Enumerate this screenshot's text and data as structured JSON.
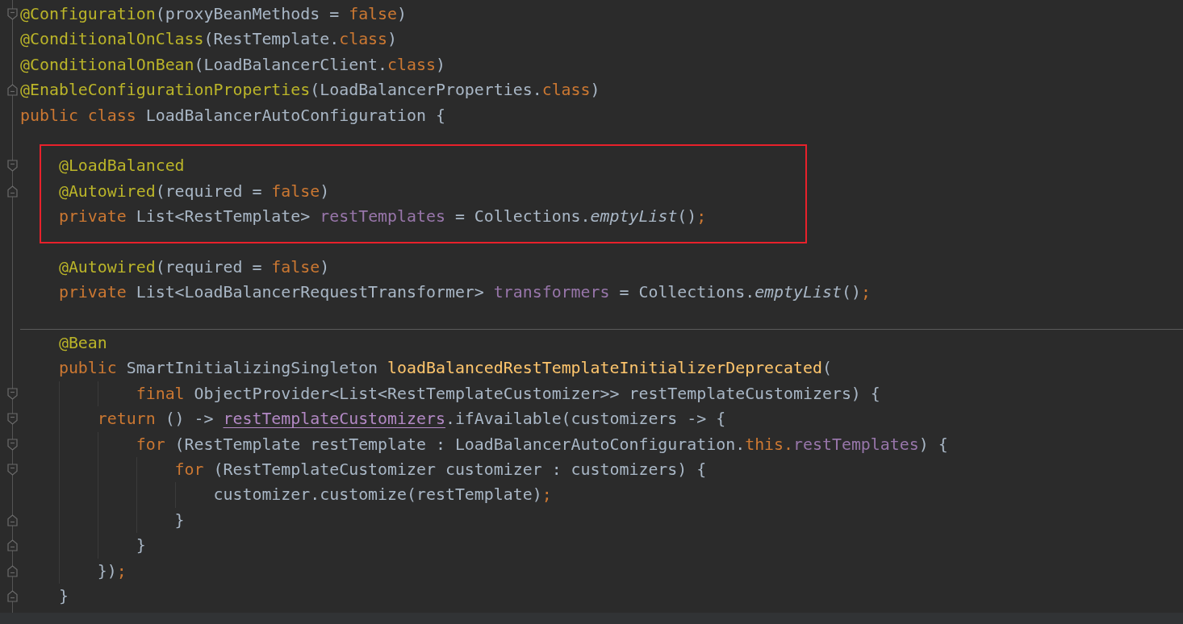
{
  "editor": {
    "sections": [
      {
        "lines": [
          {
            "fold_start": true,
            "fold_end": false,
            "highlighted": false,
            "tokens": [
              {
                "text": "@Configuration",
                "kind": "annotation"
              },
              {
                "text": "(proxyBeanMethods = ",
                "kind": "plain"
              },
              {
                "text": "false",
                "kind": "keyword"
              },
              {
                "text": ")",
                "kind": "plain"
              }
            ]
          },
          {
            "fold_start": false,
            "fold_end": false,
            "highlighted": false,
            "tokens": [
              {
                "text": "@ConditionalOnClass",
                "kind": "annotation"
              },
              {
                "text": "(RestTemplate.",
                "kind": "plain"
              },
              {
                "text": "class",
                "kind": "keyword"
              },
              {
                "text": ")",
                "kind": "plain"
              }
            ]
          },
          {
            "fold_start": false,
            "fold_end": false,
            "highlighted": false,
            "tokens": [
              {
                "text": "@ConditionalOnBean",
                "kind": "annotation"
              },
              {
                "text": "(LoadBalancerClient.",
                "kind": "plain"
              },
              {
                "text": "class",
                "kind": "keyword"
              },
              {
                "text": ")",
                "kind": "plain"
              }
            ]
          },
          {
            "fold_start": false,
            "fold_end": true,
            "highlighted": false,
            "tokens": [
              {
                "text": "@EnableConfigurationProperties",
                "kind": "annotation"
              },
              {
                "text": "(LoadBalancerProperties.",
                "kind": "plain"
              },
              {
                "text": "class",
                "kind": "keyword"
              },
              {
                "text": ")",
                "kind": "plain"
              }
            ]
          },
          {
            "fold_start": false,
            "fold_end": false,
            "highlighted": false,
            "tokens": [
              {
                "text": "public class",
                "kind": "keyword"
              },
              {
                "text": " LoadBalancerAutoConfiguration {",
                "kind": "plain"
              }
            ]
          },
          {
            "fold_start": false,
            "fold_end": false,
            "highlighted": false
          },
          {
            "fold_start": true,
            "fold_end": false,
            "highlighted": true,
            "tokens": [
              {
                "text": "    @LoadBalanced",
                "kind": "annotation"
              }
            ]
          },
          {
            "fold_start": false,
            "fold_end": true,
            "highlighted": true,
            "tokens": [
              {
                "text": "    @Autowired",
                "kind": "annotation"
              },
              {
                "text": "(required = ",
                "kind": "plain"
              },
              {
                "text": "false",
                "kind": "keyword"
              },
              {
                "text": ")",
                "kind": "plain"
              }
            ]
          },
          {
            "fold_start": false,
            "fold_end": false,
            "highlighted": true,
            "tokens": [
              {
                "text": "    private",
                "kind": "keyword"
              },
              {
                "text": " List<RestTemplate> ",
                "kind": "plain"
              },
              {
                "text": "restTemplates",
                "kind": "field"
              },
              {
                "text": " = Collections.",
                "kind": "plain"
              },
              {
                "text": "emptyList",
                "kind": "static_call"
              },
              {
                "text": "()",
                "kind": "plain"
              },
              {
                "text": ";",
                "kind": "keyword"
              }
            ]
          },
          {
            "fold_start": false,
            "fold_end": false,
            "highlighted": false
          },
          {
            "fold_start": false,
            "fold_end": false,
            "highlighted": false,
            "tokens": [
              {
                "text": "    @Autowired",
                "kind": "annotation"
              },
              {
                "text": "(required = ",
                "kind": "plain"
              },
              {
                "text": "false",
                "kind": "keyword"
              },
              {
                "text": ")",
                "kind": "plain"
              }
            ]
          },
          {
            "fold_start": false,
            "fold_end": false,
            "highlighted": false,
            "tokens": [
              {
                "text": "    private",
                "kind": "keyword"
              },
              {
                "text": " List<LoadBalancerRequestTransformer> ",
                "kind": "plain"
              },
              {
                "text": "transformers",
                "kind": "field"
              },
              {
                "text": " = Collections.",
                "kind": "plain"
              },
              {
                "text": "emptyList",
                "kind": "static_call"
              },
              {
                "text": "()",
                "kind": "plain"
              },
              {
                "text": ";",
                "kind": "keyword"
              }
            ]
          },
          {
            "fold_start": false,
            "fold_end": false,
            "highlighted": false
          }
        ]
      },
      {
        "lines": [
          {
            "fold_start": false,
            "fold_end": false,
            "highlighted": false,
            "tokens": [
              {
                "text": "    @Bean",
                "kind": "annotation"
              }
            ]
          },
          {
            "fold_start": false,
            "fold_end": false,
            "highlighted": false,
            "tokens": [
              {
                "text": "    public",
                "kind": "keyword"
              },
              {
                "text": " SmartInitializingSingleton ",
                "kind": "plain"
              },
              {
                "text": "loadBalancedRestTemplateInitializerDeprecated",
                "kind": "method_declaration"
              },
              {
                "text": "(",
                "kind": "plain"
              }
            ]
          },
          {
            "fold_start": true,
            "fold_end": false,
            "highlighted": false,
            "tokens": [
              {
                "text": "            final",
                "kind": "keyword"
              },
              {
                "text": " ObjectProvider<List<RestTemplateCustomizer>> restTemplateCustomizers) {",
                "kind": "plain"
              }
            ]
          },
          {
            "fold_start": true,
            "fold_end": false,
            "highlighted": false,
            "tokens": [
              {
                "text": "        return",
                "kind": "keyword"
              },
              {
                "text": " () -> ",
                "kind": "plain"
              },
              {
                "text": "restTemplateCustomizers",
                "kind": "captured_variable"
              },
              {
                "text": ".ifAvailable(customizers -> {",
                "kind": "plain"
              }
            ]
          },
          {
            "fold_start": true,
            "fold_end": false,
            "highlighted": false,
            "tokens": [
              {
                "text": "            for",
                "kind": "keyword"
              },
              {
                "text": " (RestTemplate restTemplate : LoadBalancerAutoConfiguration.",
                "kind": "plain"
              },
              {
                "text": "this.",
                "kind": "keyword"
              },
              {
                "text": "restTemplates",
                "kind": "field"
              },
              {
                "text": ") {",
                "kind": "plain"
              }
            ]
          },
          {
            "fold_start": true,
            "fold_end": false,
            "highlighted": false,
            "tokens": [
              {
                "text": "                for",
                "kind": "keyword"
              },
              {
                "text": " (RestTemplateCustomizer customizer : customizers) {",
                "kind": "plain"
              }
            ]
          },
          {
            "fold_start": false,
            "fold_end": false,
            "highlighted": false,
            "tokens": [
              {
                "text": "                    customizer.customize(restTemplate)",
                "kind": "plain"
              },
              {
                "text": ";",
                "kind": "keyword"
              }
            ]
          },
          {
            "fold_start": false,
            "fold_end": true,
            "highlighted": false,
            "tokens": [
              {
                "text": "                }",
                "kind": "plain"
              }
            ]
          },
          {
            "fold_start": false,
            "fold_end": true,
            "highlighted": false,
            "tokens": [
              {
                "text": "            }",
                "kind": "plain"
              }
            ]
          },
          {
            "fold_start": false,
            "fold_end": true,
            "highlighted": false,
            "tokens": [
              {
                "text": "        })",
                "kind": "plain"
              },
              {
                "text": ";",
                "kind": "keyword"
              }
            ]
          },
          {
            "fold_start": false,
            "fold_end": true,
            "highlighted": false,
            "tokens": [
              {
                "text": "    }",
                "kind": "plain"
              }
            ]
          }
        ]
      }
    ]
  }
}
